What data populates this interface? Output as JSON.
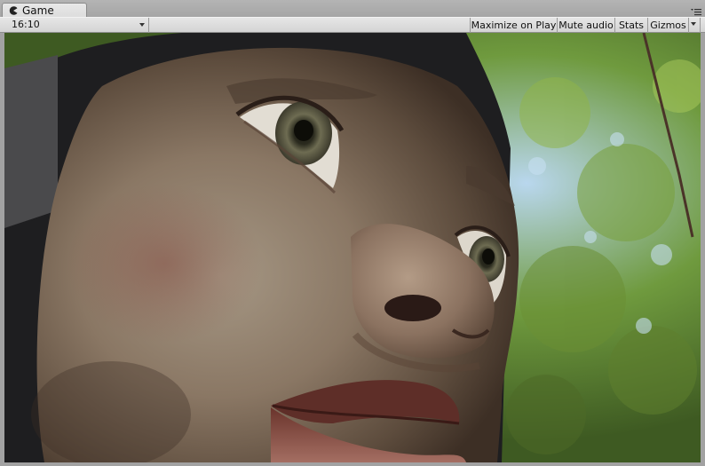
{
  "window": {
    "tab_title": "Game",
    "tab_icon": "pacman-icon",
    "menu_icon": "window-menu-icon"
  },
  "toolbar": {
    "aspect_ratio": "16:10",
    "maximize_on_play": "Maximize on Play",
    "mute_audio": "Mute audio",
    "stats": "Stats",
    "gizmos": "Gizmos"
  },
  "viewport": {
    "content": "render-scene-face-closeup"
  },
  "colors": {
    "tab_bg": "#e0e0e0",
    "toolbar_bg": "#dcdcdc",
    "window_bg": "#a2a2a2"
  }
}
